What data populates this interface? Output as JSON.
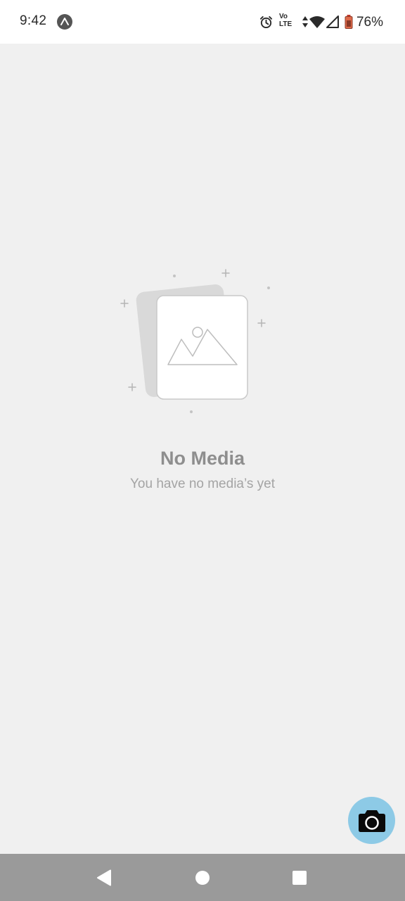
{
  "status_bar": {
    "time": "9:42",
    "app_icon": "expo-icon",
    "indicators": [
      "alarm-icon",
      "volte-icon",
      "data-arrows-icon",
      "wifi-icon",
      "cell-signal-icon",
      "battery-icon"
    ],
    "volte_top": "Vo",
    "volte_bottom": "LTE",
    "battery_percent": "76%"
  },
  "empty_state": {
    "illustration": "image-placeholder-icon",
    "title": "No Media",
    "subtitle": "You have no media’s yet"
  },
  "fab": {
    "icon": "camera-icon",
    "color": "#8dcae6"
  },
  "nav_bar": {
    "buttons": [
      "back-icon",
      "home-icon",
      "recents-icon"
    ]
  },
  "colors": {
    "background": "#f0f0f0",
    "status_bar": "#ffffff",
    "nav_bar": "#9a9a9a",
    "title_text": "#8e8e8e",
    "subtitle_text": "#a4a4a4"
  }
}
